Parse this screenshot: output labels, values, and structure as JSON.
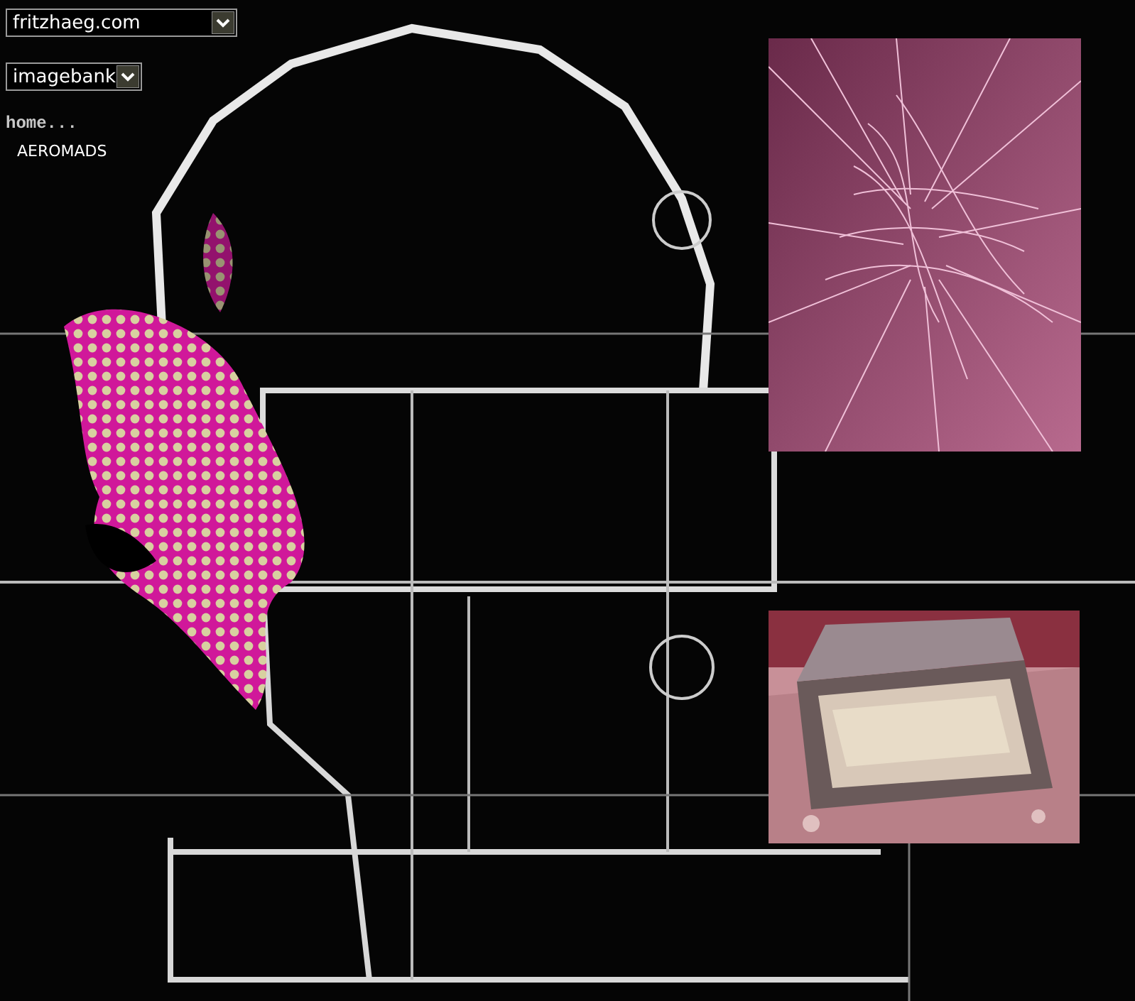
{
  "selects": [
    {
      "value": "fritzhaeg.com"
    },
    {
      "value": "imagebank"
    }
  ],
  "home_label": "home...",
  "nav_links": [
    "AEROMADS"
  ]
}
